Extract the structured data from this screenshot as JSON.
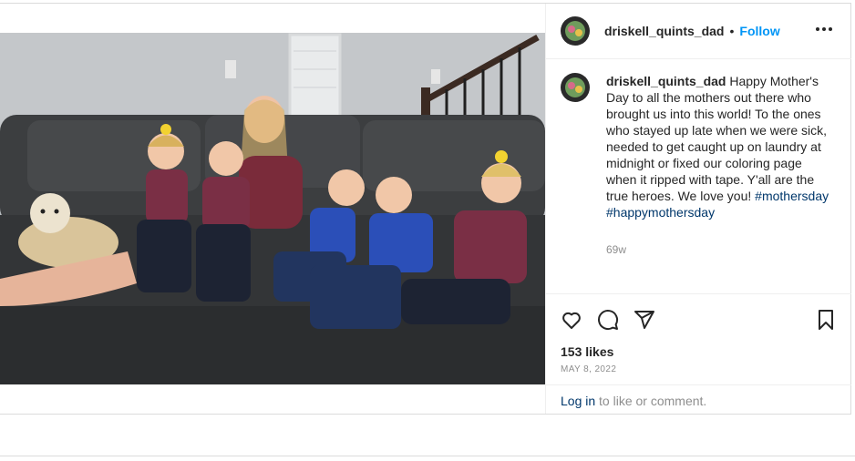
{
  "post": {
    "username": "driskell_quints_dad",
    "follow_label": "Follow",
    "separator": "•",
    "more_icon": "more-options-icon",
    "caption_text": "Happy Mother's Day to all the mothers out there who brought us into this world! To the ones who stayed up late when we were sick, needed to get caught up on laundry at midnight or fixed our coloring page when it ripped with tape. Y'all are the true heroes. We love you!",
    "hashtags": [
      "#mothersday",
      "#happymothersday"
    ],
    "age": "69w",
    "likes": "153 likes",
    "date": "MAY 8, 2022",
    "login_link": "Log in",
    "login_rest": " to like or comment."
  },
  "icons": [
    "heart-icon",
    "comment-icon",
    "share-icon",
    "bookmark-icon"
  ],
  "colors": {
    "follow": "#0095f6",
    "hashtag": "#00376b",
    "muted": "#8e8e8e"
  }
}
